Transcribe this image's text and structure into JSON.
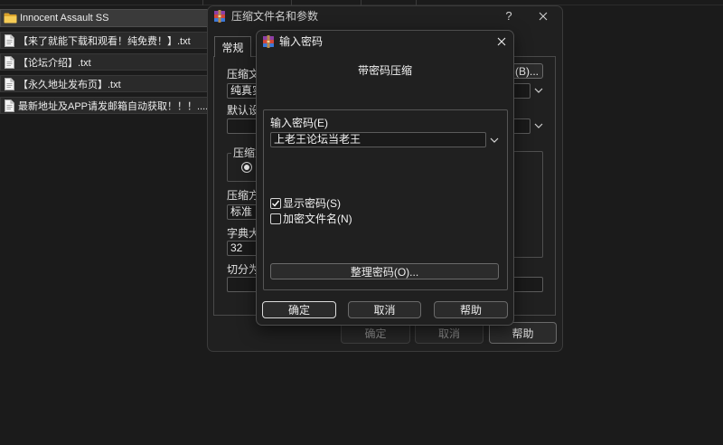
{
  "file_list": {
    "items": [
      {
        "label": "Innocent Assault SS",
        "icon": "folder-icon",
        "selected": true
      },
      {
        "label": "【来了就能下载和观看！纯免费！】.txt",
        "icon": "text-file-icon",
        "selected": false
      },
      {
        "label": "【论坛介绍】.txt",
        "icon": "text-file-icon",
        "selected": false
      },
      {
        "label": "【永久地址发布页】.txt",
        "icon": "text-file-icon",
        "selected": false
      },
      {
        "label": "最新地址及APP请发邮箱自动获取！！！....",
        "icon": "text-file-icon",
        "selected": false
      }
    ]
  },
  "archive_dialog": {
    "title": "压缩文件名和参数",
    "icon": "winrar-icon",
    "help_button": "?",
    "close_icon": "close-icon",
    "tabs": [
      {
        "label": "常规",
        "active": true
      }
    ],
    "archive_name": {
      "label": "压缩文",
      "value": "纯真实"
    },
    "browse_button": "(B)...",
    "profile": {
      "label": "默认设"
    },
    "format_group": {
      "label": "压缩文",
      "radio_selected": true
    },
    "method": {
      "label": "压缩方",
      "value": "标准"
    },
    "dictionary": {
      "label": "字典大",
      "value": "32"
    },
    "split": {
      "label": "切分为"
    },
    "buttons": {
      "ok": "确定",
      "cancel": "取消",
      "help": "帮助"
    }
  },
  "password_dialog": {
    "title": "输入密码",
    "icon": "winrar-icon",
    "close_icon": "close-icon",
    "heading": "带密码压缩",
    "password": {
      "label": "输入密码(E)",
      "value": "上老王论坛当老王"
    },
    "show_password": {
      "label": "显示密码(S)",
      "checked": true
    },
    "encrypt_file_names": {
      "label": "加密文件名(N)",
      "checked": false
    },
    "organize_button": "整理密码(O)...",
    "buttons": {
      "ok": "确定",
      "cancel": "取消",
      "help": "帮助"
    }
  }
}
